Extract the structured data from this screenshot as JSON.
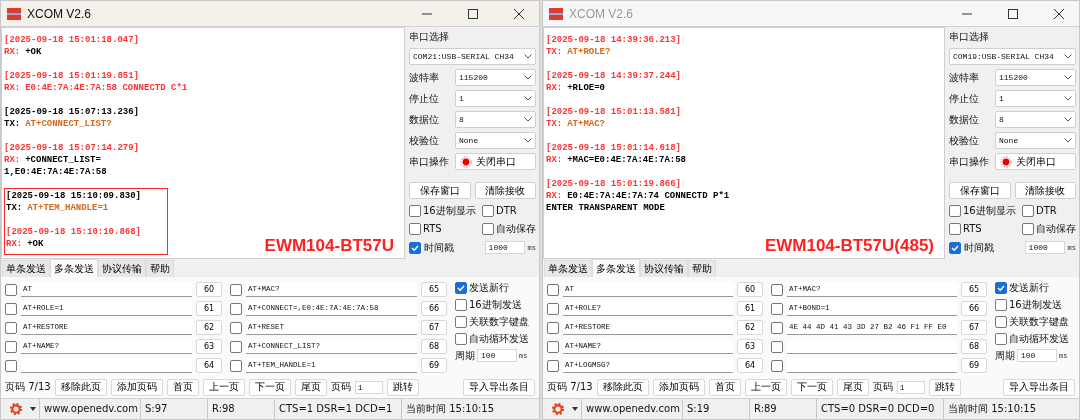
{
  "windows": [
    {
      "title": "XCOM V2.6",
      "active": true,
      "log": [
        {
          "entries": [
            {
              "time": {
                "text": "[2025-09-18 15:01:18.047]",
                "color": "#ff3333"
              },
              "lines": [
                {
                  "prefix": {
                    "text": "RX:",
                    "color": "#ff3333"
                  },
                  "text": "+OK",
                  "color": "#000000"
                }
              ]
            },
            {
              "time": {
                "text": "[2025-09-18 15:01:19.851]",
                "color": "#ff3333"
              },
              "lines": [
                {
                  "prefix": {
                    "text": "RX:",
                    "color": "#ff3333"
                  },
                  "text": "E0:4E:7A:4E:7A:58 CONNECTD C*1",
                  "color": "#ff3333"
                }
              ]
            },
            {
              "time": {
                "text": "[2025-09-18 15:07:13.236]",
                "color": "#000000"
              },
              "lines": [
                {
                  "prefix": {
                    "text": "TX:",
                    "color": "#000000"
                  },
                  "text": "AT+CONNECT_LIST?",
                  "color": "#d2691e"
                }
              ]
            },
            {
              "time": {
                "text": "[2025-09-18 15:07:14.279]",
                "color": "#ff3333"
              },
              "lines": [
                {
                  "prefix": {
                    "text": "RX:",
                    "color": "#ff3333"
                  },
                  "text": "+CONNECT_LIST=",
                  "color": "#000000"
                },
                {
                  "text": "1,E0:4E:7A:4E:7A:58",
                  "color": "#000000"
                }
              ]
            }
          ]
        },
        {
          "boxed": true,
          "entries": [
            {
              "time": {
                "text": "[2025-09-18 15:10:09.830]",
                "color": "#000000"
              },
              "lines": [
                {
                  "prefix": {
                    "text": "TX:",
                    "color": "#000000"
                  },
                  "text": "AT+TEM_HANDLE=1",
                  "color": "#d2691e"
                }
              ]
            },
            {
              "time": {
                "text": "[2025-09-18 15:10:10.868]",
                "color": "#ff3333"
              },
              "lines": [
                {
                  "prefix": {
                    "text": "RX:",
                    "color": "#ff3333"
                  },
                  "text": "+OK",
                  "color": "#000000"
                }
              ]
            }
          ]
        }
      ],
      "annotation": "EWM104-BT57U",
      "panel": {
        "port_label": "串口选择",
        "port": "COM21:USB-SERIAL CH34",
        "settings": [
          {
            "label": "波特率",
            "value": "115200"
          },
          {
            "label": "停止位",
            "value": "1"
          },
          {
            "label": "数据位",
            "value": "8"
          },
          {
            "label": "校验位",
            "value": "None"
          }
        ],
        "operation_label": "串口操作",
        "operation_button": "关闭串口",
        "buttons": [
          "保存窗口",
          "清除接收"
        ],
        "checkboxes": [
          {
            "label": "16进制显示",
            "checked": false
          },
          {
            "label": "DTR",
            "checked": false
          },
          {
            "label": "RTS",
            "checked": false
          },
          {
            "label": "自动保存",
            "checked": false
          },
          {
            "label": "时间戳",
            "checked": true
          }
        ],
        "interval": "1000",
        "interval_unit": "ms"
      },
      "tabs": [
        {
          "label": "单条发送",
          "selected": false
        },
        {
          "label": "多条发送",
          "selected": true
        },
        {
          "label": "协议传输",
          "selected": false
        },
        {
          "label": "帮助",
          "selected": false
        }
      ],
      "send": {
        "items": [
          {
            "checked": false,
            "text": "AT",
            "button": "60"
          },
          {
            "checked": false,
            "text": "AT+ROLE=1",
            "button": "61"
          },
          {
            "checked": false,
            "text": "AT+RESTORE",
            "button": "62"
          },
          {
            "checked": false,
            "text": "AT+NAME?",
            "button": "63"
          },
          {
            "checked": false,
            "button": "64"
          },
          {
            "checked": false,
            "text": "AT+MAC?",
            "button": "65"
          },
          {
            "checked": false,
            "text": "AT+CONNECT=,E0:4E:7A:4E:7A:58",
            "button": "66"
          },
          {
            "checked": false,
            "text": "AT+RESET",
            "button": "67"
          },
          {
            "checked": false,
            "text": "AT+CONNECT_LIST?",
            "button": "68"
          },
          {
            "checked": false,
            "text": "AT+TEM_HANDLE=1",
            "button": "69"
          }
        ],
        "options": [
          {
            "label": "发送新行",
            "checked": true
          },
          {
            "label": "16进制发送",
            "checked": false
          },
          {
            "label": "关联数字键盘",
            "checked": false
          },
          {
            "label": "自动循环发送",
            "checked": false
          }
        ],
        "period_label": "周期",
        "period": "100",
        "period_unit": "ms"
      },
      "pager": {
        "page": "页码 7/13",
        "buttons": [
          "移除此页",
          "添加页码",
          "首页",
          "上一页",
          "下一页",
          "尾页"
        ],
        "page_label": "页码",
        "page_input": "1",
        "go": "跳转",
        "import_export": "导入导出条目"
      },
      "status": {
        "url": "www.openedv.com",
        "sent": "S:97",
        "received": "R:98",
        "lines": "CTS=1 DSR=1 DCD=1",
        "time": "当前时间 15:10:15"
      }
    },
    {
      "title": "XCOM V2.6",
      "active": false,
      "log": [
        {
          "entries": [
            {
              "time": {
                "text": "[2025-09-18 14:39:36.213]",
                "color": "#ff3333"
              },
              "lines": [
                {
                  "prefix": {
                    "text": "TX:",
                    "color": "#ff3333"
                  },
                  "text": "AT+ROLE?",
                  "color": "#d2691e"
                }
              ]
            },
            {
              "time": {
                "text": "[2025-09-18 14:39:37.244]",
                "color": "#ff3333"
              },
              "lines": [
                {
                  "prefix": {
                    "text": "RX:",
                    "color": "#ff3333"
                  },
                  "text": "+RLOE=0",
                  "color": "#000000"
                }
              ]
            },
            {
              "time": {
                "text": "[2025-09-18 15:01:13.581]",
                "color": "#ff3333"
              },
              "lines": [
                {
                  "prefix": {
                    "text": "TX:",
                    "color": "#ff3333"
                  },
                  "text": "AT+MAC?",
                  "color": "#d2691e"
                }
              ]
            },
            {
              "time": {
                "text": "[2025-09-18 15:01:14.618]",
                "color": "#ff3333"
              },
              "lines": [
                {
                  "prefix": {
                    "text": "RX:",
                    "color": "#ff3333"
                  },
                  "text": "+MAC=E0:4E:7A:4E:7A:58",
                  "color": "#000000"
                }
              ]
            },
            {
              "time": {
                "text": "[2025-09-18 15:01:19.866]",
                "color": "#ff3333"
              },
              "lines": [
                {
                  "prefix": {
                    "text": "RX:",
                    "color": "#ff3333"
                  },
                  "text": "E0:4E:7A:4E:7A:74 CONNECTD P*1",
                  "color": "#000000"
                },
                {
                  "text": "ENTER TRANSPARENT MODE",
                  "color": "#000000"
                }
              ]
            }
          ]
        }
      ],
      "annotation": "EWM104-BT57U(485)",
      "panel": {
        "port_label": "串口选择",
        "port": "COM19:USB-SERIAL CH34",
        "settings": [
          {
            "label": "波特率",
            "value": "115200"
          },
          {
            "label": "停止位",
            "value": "1"
          },
          {
            "label": "数据位",
            "value": "8"
          },
          {
            "label": "校验位",
            "value": "None"
          }
        ],
        "operation_label": "串口操作",
        "operation_button": "关闭串口",
        "buttons": [
          "保存窗口",
          "清除接收"
        ],
        "checkboxes": [
          {
            "label": "16进制显示",
            "checked": false
          },
          {
            "label": "DTR",
            "checked": false
          },
          {
            "label": "RTS",
            "checked": false
          },
          {
            "label": "自动保存",
            "checked": false
          },
          {
            "label": "时间戳",
            "checked": true
          }
        ],
        "interval": "1000",
        "interval_unit": "ms"
      },
      "tabs": [
        {
          "label": "单条发送",
          "selected": false
        },
        {
          "label": "多条发送",
          "selected": true
        },
        {
          "label": "协议传输",
          "selected": false
        },
        {
          "label": "帮助",
          "selected": false
        }
      ],
      "send": {
        "items": [
          {
            "checked": false,
            "text": "AT",
            "button": "60"
          },
          {
            "checked": false,
            "text": "AT+ROLE?",
            "button": "61"
          },
          {
            "checked": false,
            "text": "AT+RESTORE",
            "button": "62"
          },
          {
            "checked": false,
            "text": "AT+NAME?",
            "button": "63"
          },
          {
            "checked": false,
            "text": "AT+LOGMSG?",
            "button": "64"
          },
          {
            "checked": false,
            "text": "AT+MAC?",
            "button": "65"
          },
          {
            "checked": false,
            "text": "AT+BOND=1",
            "button": "66"
          },
          {
            "checked": false,
            "text": "4E 44 4D 41 43 3D 27 B2 46 F1 FF E0",
            "button": "67"
          },
          {
            "checked": false,
            "button": "68"
          },
          {
            "checked": false,
            "button": "69"
          }
        ],
        "options": [
          {
            "label": "发送新行",
            "checked": true
          },
          {
            "label": "16进制发送",
            "checked": false
          },
          {
            "label": "关联数字键盘",
            "checked": false
          },
          {
            "label": "自动循环发送",
            "checked": false
          }
        ],
        "period_label": "周期",
        "period": "100",
        "period_unit": "ms"
      },
      "pager": {
        "page": "页码 7/13",
        "buttons": [
          "移除此页",
          "添加页码",
          "首页",
          "上一页",
          "下一页",
          "尾页"
        ],
        "page_label": "页码",
        "page_input": "1",
        "go": "跳转",
        "import_export": "导入导出条目"
      },
      "status": {
        "url": "www.openedv.com",
        "sent": "S:19",
        "received": "R:89",
        "lines": "CTS=0 DSR=0 DCD=0",
        "time": "当前时间 15:10:15"
      }
    }
  ]
}
